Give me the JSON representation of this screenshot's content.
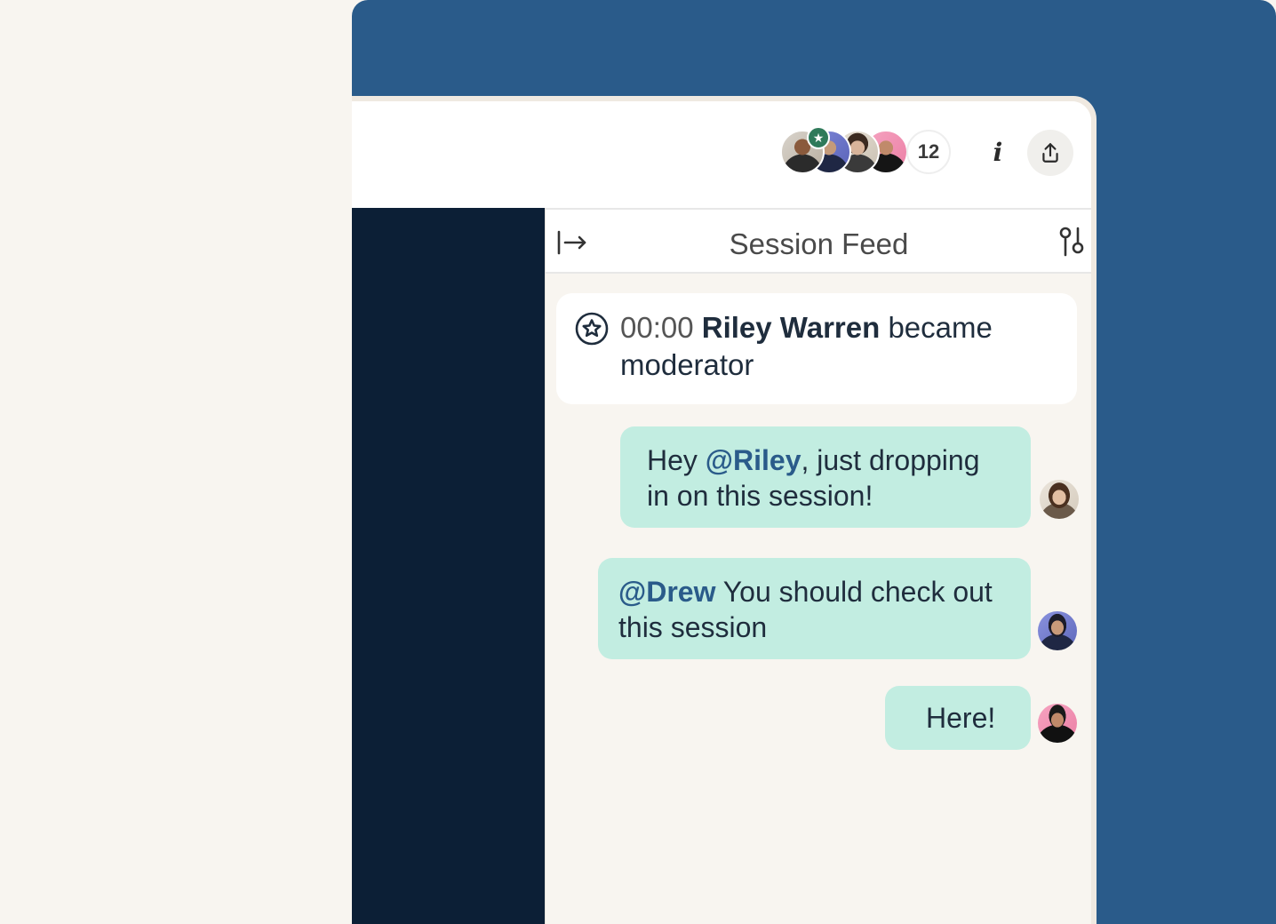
{
  "header": {
    "participant_count": "12",
    "info_icon": "info-icon",
    "share_icon": "share-icon",
    "moderator_badge_icon": "star-icon",
    "participants": [
      "participant-1",
      "participant-2",
      "participant-3",
      "participant-4"
    ]
  },
  "feed": {
    "title": "Session Feed",
    "collapse_icon": "collapse-right-icon",
    "filter_icon": "sliders-icon",
    "event": {
      "icon": "star-circle-icon",
      "time": "00:00",
      "name": "Riley Warren",
      "text": " became moderator"
    },
    "messages": [
      {
        "prefix": "Hey ",
        "mention": "@Riley",
        "text": ", just dropping in on this session!"
      },
      {
        "prefix": "",
        "mention": "@Drew",
        "text": " You should check out this session"
      },
      {
        "prefix": "",
        "mention": "",
        "text": "Here!"
      }
    ]
  },
  "colors": {
    "brand_blue": "#2a5b8a",
    "dark_navy": "#0c1f36",
    "bubble_mint": "#c2ede1",
    "moderator_green": "#2f7a5a",
    "background_cream": "#f8f5f0"
  }
}
